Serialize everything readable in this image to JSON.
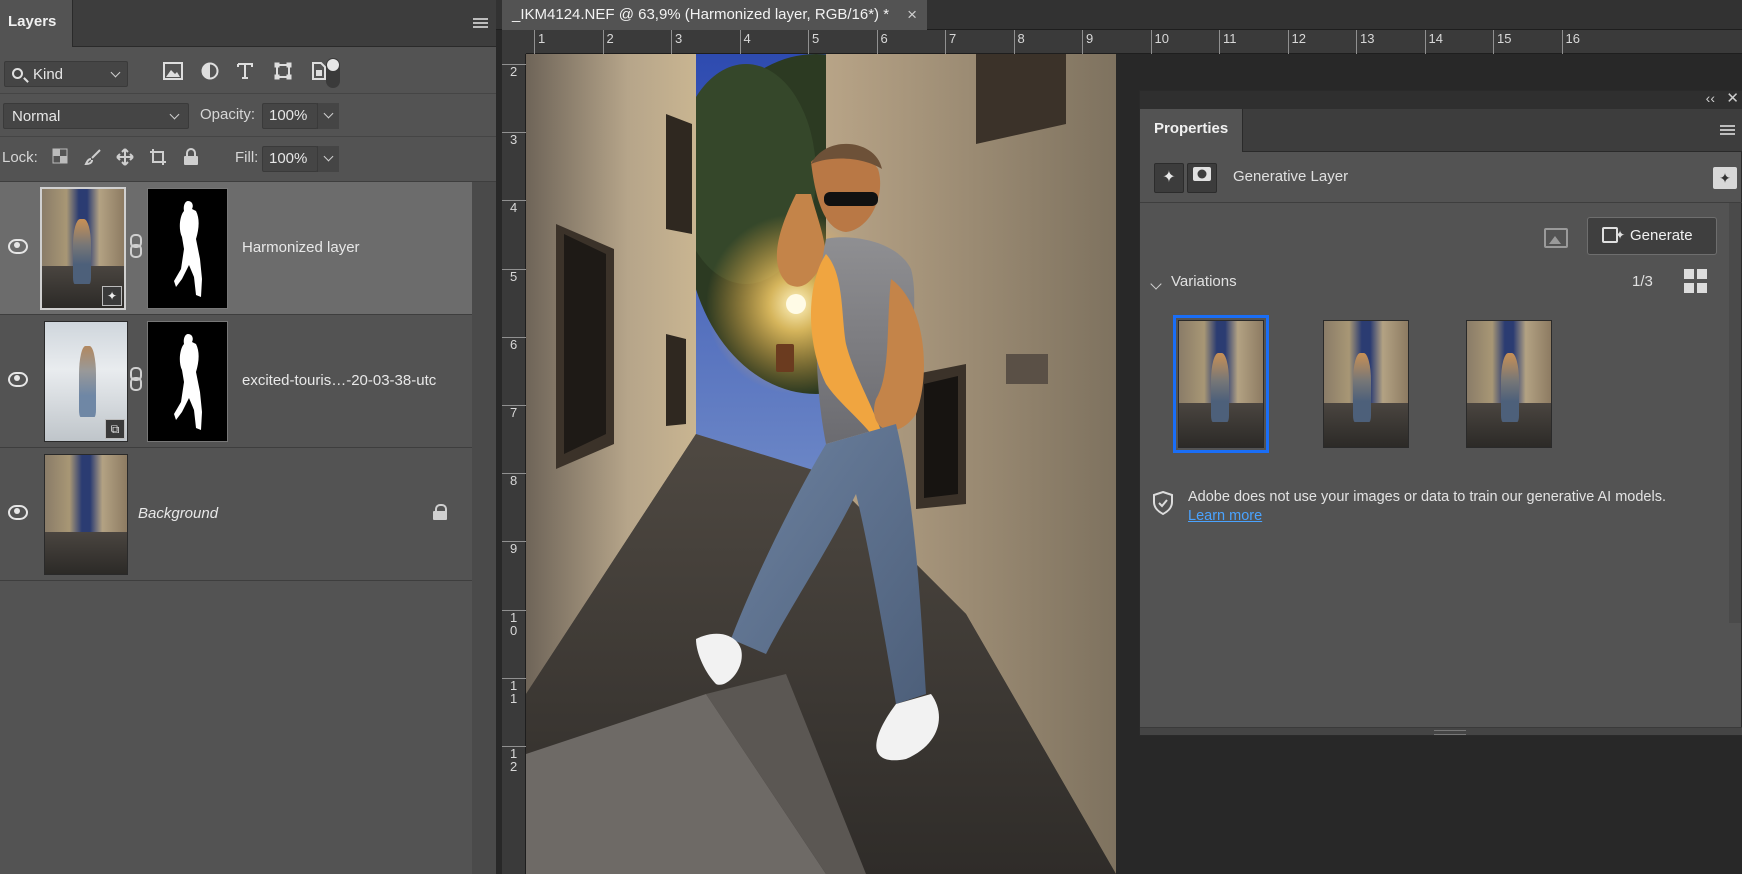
{
  "layers_panel": {
    "tab_label": "Layers",
    "filter": {
      "kind_label": "Kind"
    },
    "blend_mode": "Normal",
    "opacity_label": "Opacity:",
    "opacity_value": "100%",
    "lock_label": "Lock:",
    "fill_label": "Fill:",
    "fill_value": "100%",
    "layers": [
      {
        "name": "Harmonized layer",
        "selected": true,
        "visible": true,
        "has_mask": true,
        "badge": "generative-icon"
      },
      {
        "name": "excited-touris…-20-03-38-utc",
        "selected": false,
        "visible": true,
        "has_mask": true,
        "badge": "smart-object-icon"
      },
      {
        "name": "Background",
        "selected": false,
        "visible": true,
        "has_mask": false,
        "locked": true
      }
    ]
  },
  "document": {
    "tab_title": "_IKM4124.NEF @ 63,9% (Harmonized layer, RGB/16*) *",
    "close_glyph": "×",
    "ruler_top": [
      "1",
      "2",
      "3",
      "4",
      "5",
      "6",
      "7",
      "8",
      "9",
      "10",
      "11",
      "12",
      "13",
      "14",
      "15",
      "16"
    ],
    "ruler_left": [
      "2",
      "3",
      "4",
      "5",
      "6",
      "7",
      "8",
      "9",
      "1\n0",
      "1\n1",
      "1\n2"
    ]
  },
  "properties": {
    "tab_label": "Properties",
    "layer_type": "Generative Layer",
    "generate_label": "Generate",
    "variations_label": "Variations",
    "variations_count": "1/3",
    "variation_count_total": 3,
    "selected_variation": 1,
    "info_text": "Adobe does not use your images or data to train our generative AI models.",
    "learn_more": "Learn more"
  },
  "colors": {
    "panel_bg": "#535353",
    "selected_layer": "#6c6c6c",
    "accent_blue": "#1a6ef7",
    "link_blue": "#4aa3ff"
  }
}
